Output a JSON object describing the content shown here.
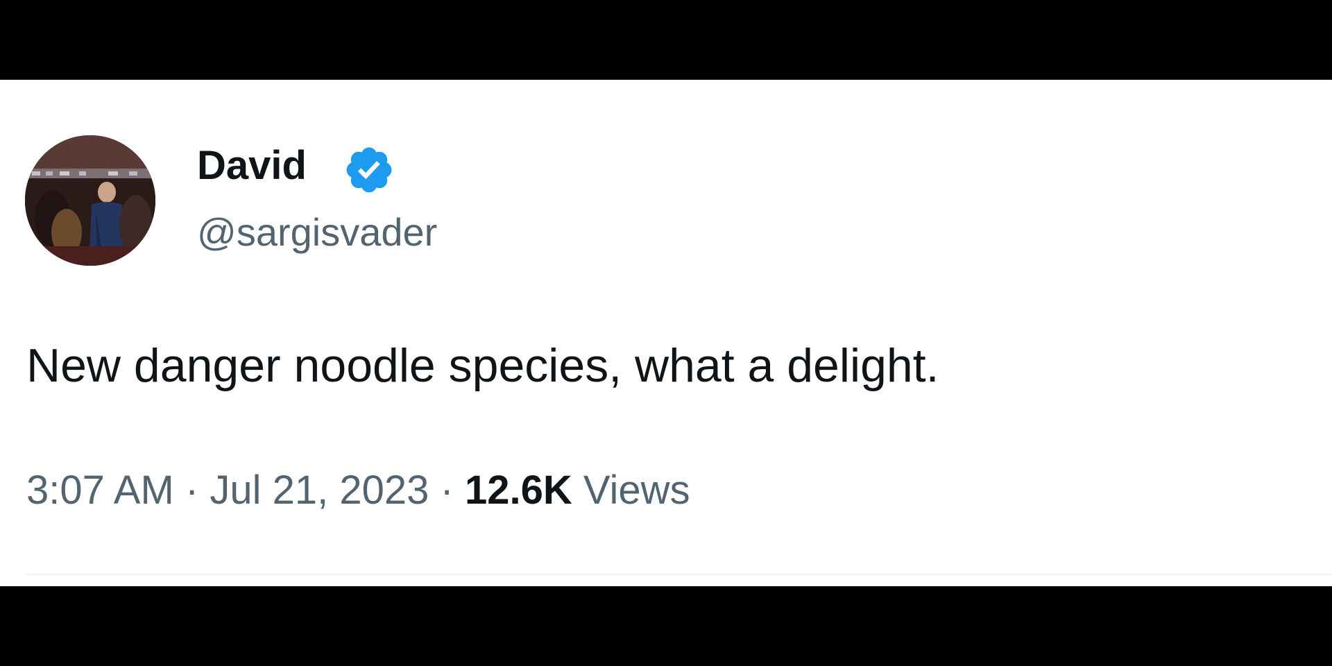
{
  "tweet": {
    "author": {
      "display_name": "David",
      "handle": "@sargisvader",
      "verified": true,
      "verified_icon": "verified-badge-icon",
      "avatar": "avatar-photo"
    },
    "text": "New danger noodle species, what a delight.",
    "time": "3:07 AM",
    "separator": "·",
    "date": "Jul 21, 2023",
    "views_count": "12.6K",
    "views_label": "Views"
  },
  "colors": {
    "primary_text": "#0f1419",
    "secondary_text": "#536471",
    "verified_blue": "#1d9bf0",
    "background": "#ffffff",
    "letterbox": "#000000"
  }
}
